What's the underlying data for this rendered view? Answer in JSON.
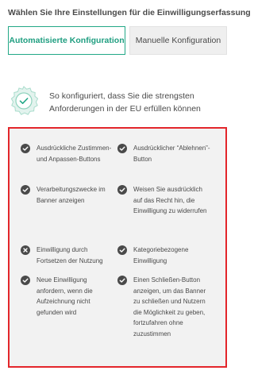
{
  "header": {
    "title": "Wählen Sie Ihre Einstellungen für die Einwilligungserfassung"
  },
  "mode_buttons": {
    "automatic": "Automatisierte Konfiguration",
    "manual": "Manuelle Konfiguration",
    "selected": "automatic"
  },
  "info": {
    "icon": "seal-check-icon",
    "text": "So konfiguriert, dass Sie die strengsten Anforderungen in der EU erfüllen können"
  },
  "features": [
    {
      "label": "Ausdrückliche Zustimmen- und Anpassen-Buttons",
      "status": "enabled",
      "icon": "check-circle-icon"
    },
    {
      "label": "Ausdrücklicher “Ablehnen”-Button",
      "status": "enabled",
      "icon": "check-circle-icon"
    },
    {
      "label": "Verarbeitungszwecke im Banner anzeigen",
      "status": "enabled",
      "icon": "check-circle-icon"
    },
    {
      "label": "Weisen Sie ausdrücklich auf das Recht hin, die Einwilligung zu widerrufen",
      "status": "enabled",
      "icon": "check-circle-icon"
    },
    {
      "label": "Einwilligung durch Fortsetzen der Nutzung",
      "status": "disabled",
      "icon": "x-circle-icon"
    },
    {
      "label": "Kategoriebezogene Einwilligung",
      "status": "enabled",
      "icon": "check-circle-icon"
    },
    {
      "label": "Neue Einwilligung anfordern, wenn die Aufzeichnung nicht gefunden wird",
      "status": "enabled",
      "icon": "check-circle-icon"
    },
    {
      "label": "Einen Schließen-Button anzeigen, um das Banner zu schließen und Nutzern die Möglichkeit zu geben, fortzufahren ohne zuzustimmen",
      "status": "enabled",
      "icon": "check-circle-icon"
    }
  ],
  "colors": {
    "accent": "#22a887",
    "highlight_border": "#e3262b",
    "icon": "#4a4a4a"
  }
}
